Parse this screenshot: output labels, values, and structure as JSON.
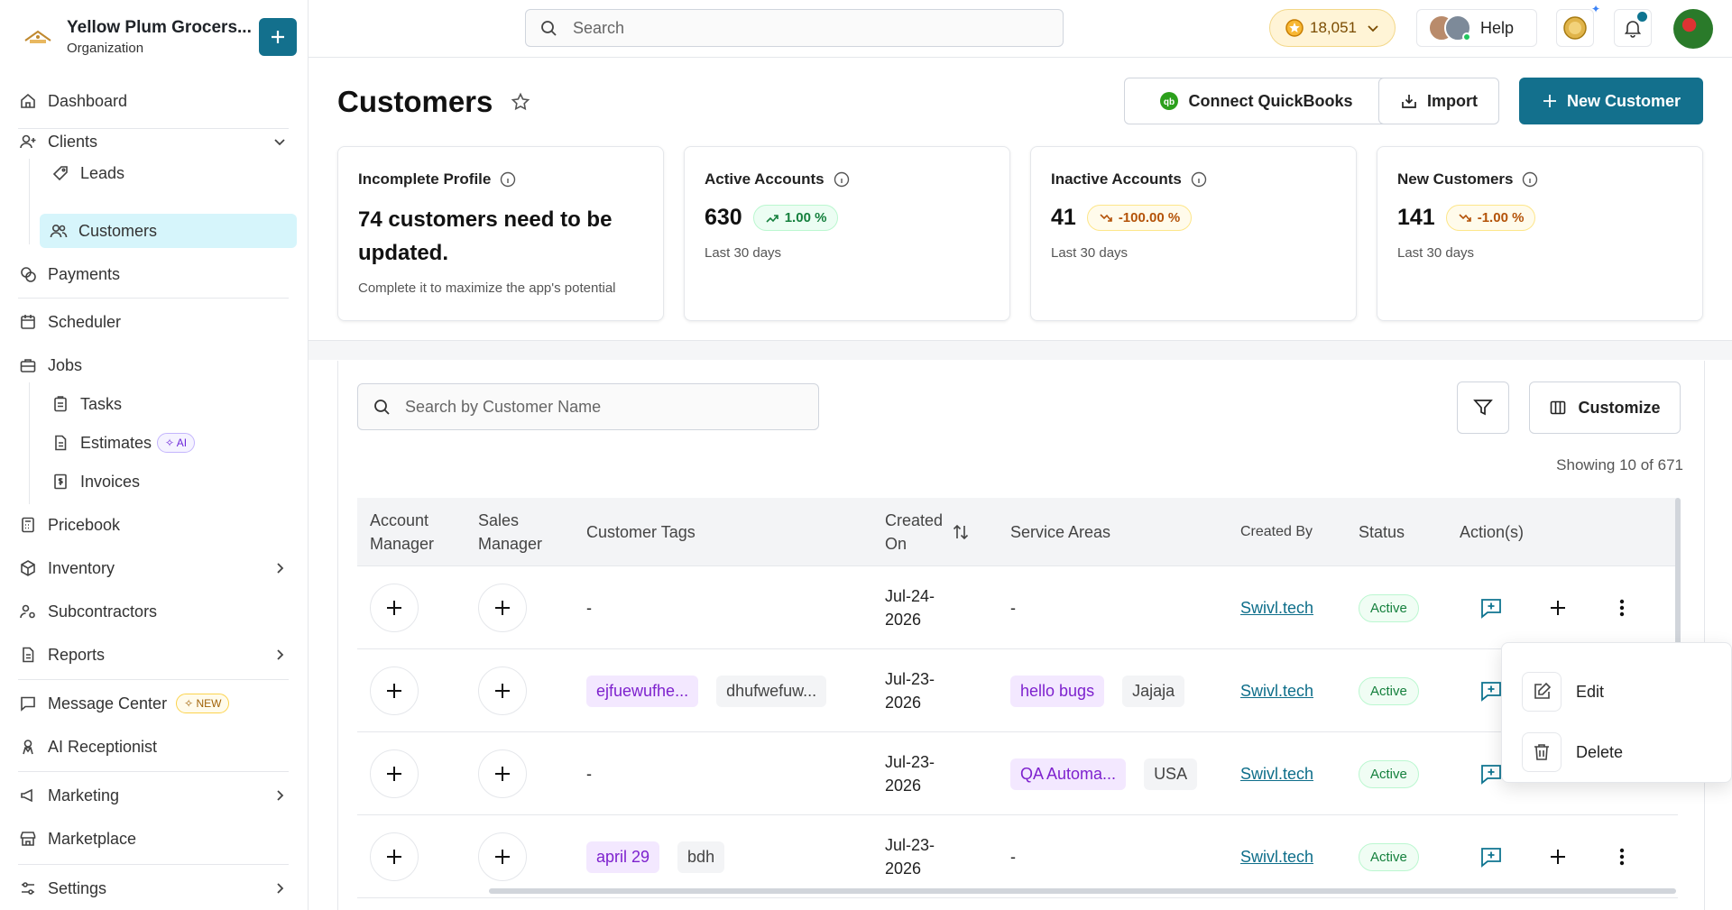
{
  "org": {
    "name": "Yellow Plum Grocers...",
    "subtitle": "Organization"
  },
  "sidebar": {
    "dashboard": "Dashboard",
    "clients": "Clients",
    "leads": "Leads",
    "customers": "Customers",
    "payments": "Payments",
    "scheduler": "Scheduler",
    "jobs": "Jobs",
    "tasks": "Tasks",
    "estimates": "Estimates",
    "estimates_badge": "AI",
    "invoices": "Invoices",
    "pricebook": "Pricebook",
    "inventory": "Inventory",
    "subcontractors": "Subcontractors",
    "reports": "Reports",
    "message_center": "Message Center",
    "message_badge": "NEW",
    "ai_receptionist": "AI Receptionist",
    "marketing": "Marketing",
    "marketplace": "Marketplace",
    "settings": "Settings"
  },
  "topbar": {
    "search_placeholder": "Search",
    "credits": "18,051",
    "help": "Help"
  },
  "page": {
    "title": "Customers",
    "connect_qb": "Connect QuickBooks",
    "import": "Import",
    "new_customer": "New Customer"
  },
  "cards": {
    "incomplete": {
      "title": "Incomplete Profile",
      "text": "74 customers need to be updated.",
      "sub": "Complete it to maximize the app's potential"
    },
    "active": {
      "title": "Active Accounts",
      "value": "630",
      "change": "1.00 %",
      "period": "Last 30 days"
    },
    "inactive": {
      "title": "Inactive Accounts",
      "value": "41",
      "change": "-100.00 %",
      "period": "Last 30 days"
    },
    "new": {
      "title": "New Customers",
      "value": "141",
      "change": "-1.00 %",
      "period": "Last 30 days"
    }
  },
  "table": {
    "search_placeholder": "Search by Customer Name",
    "customize": "Customize",
    "showing": "Showing 10 of 671",
    "headers": {
      "account_manager": "Account Manager",
      "sales_manager": "Sales Manager",
      "customer_tags": "Customer Tags",
      "created_on": "Created On",
      "service_areas": "Service Areas",
      "created_by": "Created By",
      "status": "Status",
      "actions": "Action(s)"
    },
    "rows": [
      {
        "tags": [],
        "tags_empty": "-",
        "date_a": "Jul-24-",
        "date_b": "2026",
        "areas": [],
        "areas_empty": "-",
        "created_by": "Swivl.tech",
        "status": "Active"
      },
      {
        "tags": [
          "ejfuewufhe...",
          "dhufwefuw..."
        ],
        "date_a": "Jul-23-",
        "date_b": "2026",
        "areas": [
          "hello bugs",
          "Jajaja"
        ],
        "created_by": "Swivl.tech",
        "status": "Active"
      },
      {
        "tags": [],
        "tags_empty": "-",
        "date_a": "Jul-23-",
        "date_b": "2026",
        "areas": [
          "QA Automa...",
          "USA"
        ],
        "created_by": "Swivl.tech",
        "status": "Active"
      },
      {
        "tags": [
          "april 29",
          "bdh"
        ],
        "date_a": "Jul-23-",
        "date_b": "2026",
        "areas": [],
        "areas_empty": "-",
        "created_by": "Swivl.tech",
        "status": "Active"
      }
    ]
  },
  "menu": {
    "edit": "Edit",
    "delete": "Delete"
  },
  "colors": {
    "primary": "#13708d",
    "active_nav": "#d6f5fb",
    "status_green": "#15803d"
  }
}
